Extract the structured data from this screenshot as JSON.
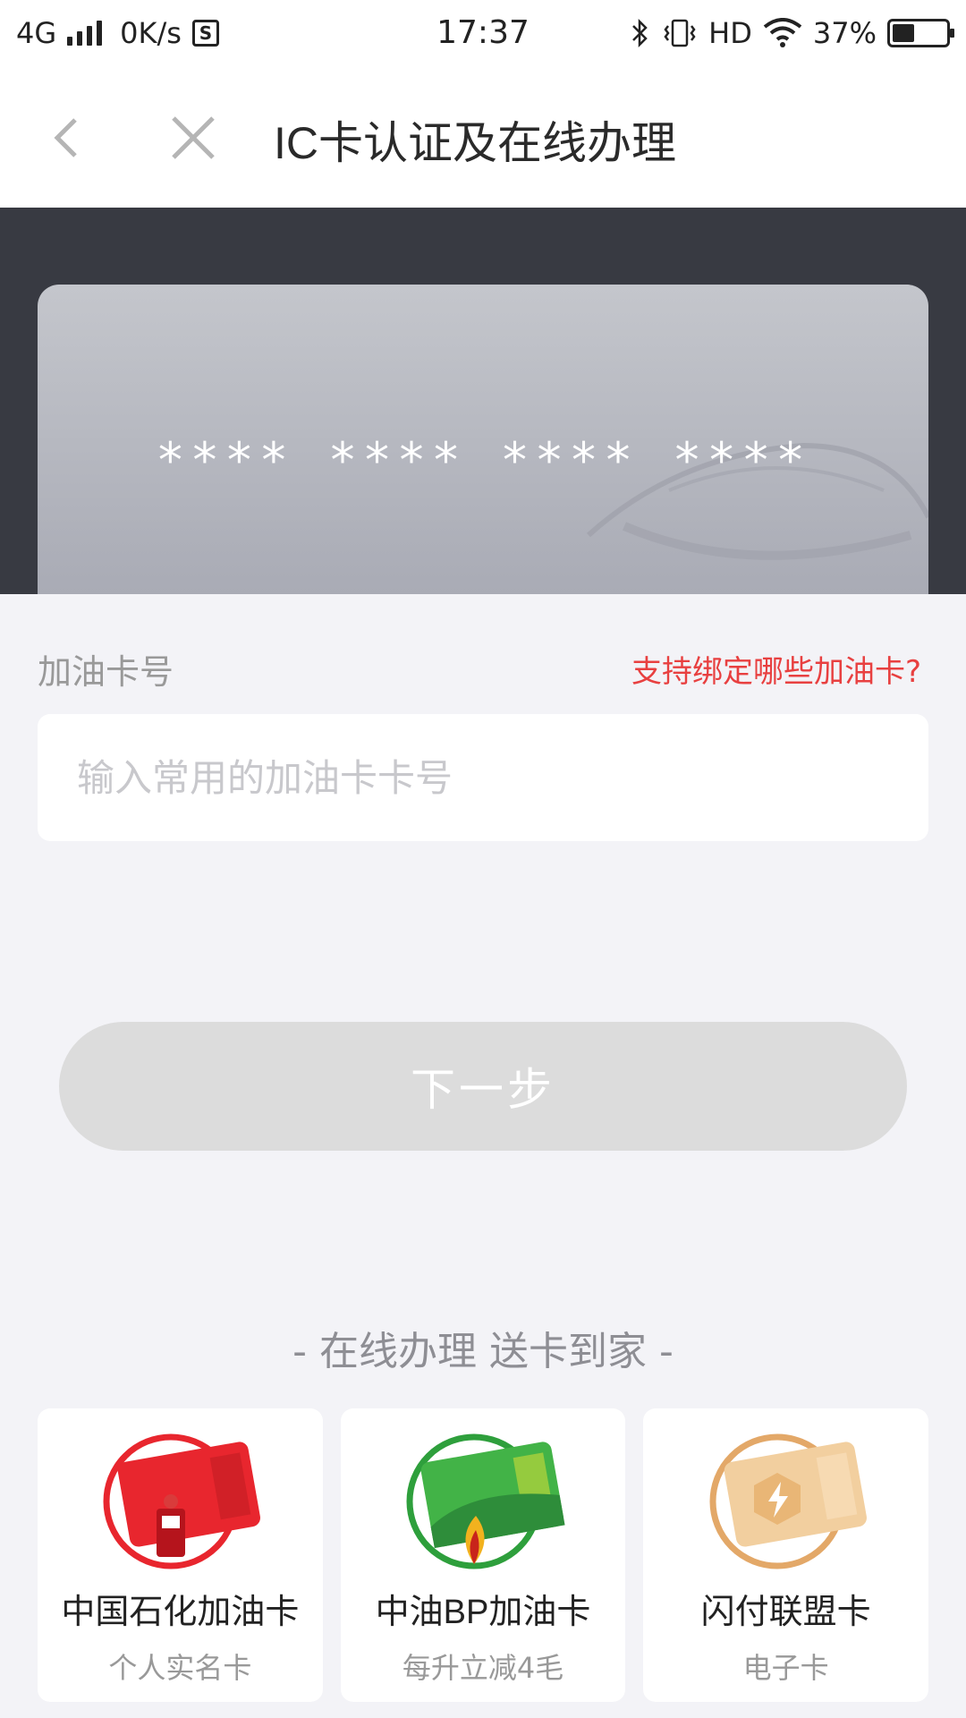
{
  "status_bar": {
    "network": "4G",
    "speed": "0K/s",
    "s_icon": "S",
    "time": "17:37",
    "hd": "HD",
    "battery": "37%",
    "battery_level": 0.37
  },
  "nav": {
    "title": "IC卡认证及在线办理"
  },
  "card": {
    "masked_number": "**** **** **** ****"
  },
  "form": {
    "label": "加油卡号",
    "help_link": "支持绑定哪些加油卡?",
    "placeholder": "输入常用的加油卡卡号",
    "value": ""
  },
  "next_button": {
    "label": "下一步"
  },
  "section": {
    "title": "- 在线办理 送卡到家 -"
  },
  "offers": [
    {
      "title": "中国石化加油卡",
      "subtitle": "个人实名卡",
      "color": "#e8262e",
      "icon": "sinopec-card-icon"
    },
    {
      "title": "中油BP加油卡",
      "subtitle": "每升立减4毛",
      "color": "#2e9f3c",
      "icon": "petrochina-bp-card-icon"
    },
    {
      "title": "闪付联盟卡",
      "subtitle": "电子卡",
      "color": "#e3a868",
      "icon": "quickpass-card-icon"
    }
  ],
  "colors": {
    "accent_red": "#e84040",
    "header_dark": "#383a42",
    "page_bg": "#f3f3f7"
  }
}
